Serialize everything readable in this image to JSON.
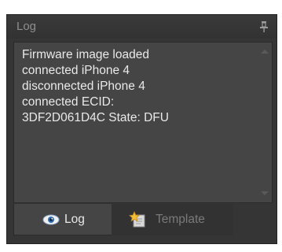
{
  "panel": {
    "title": "Log",
    "pin_icon": "pin-icon"
  },
  "log": {
    "lines": [
      "Firmware image loaded",
      "connected iPhone 4",
      "disconnected iPhone 4",
      "connected ECID:",
      "3DF2D061D4C State: DFU"
    ]
  },
  "tabs": [
    {
      "label": "Log",
      "icon": "eye-icon",
      "active": true
    },
    {
      "label": "Template",
      "icon": "star-document-icon",
      "active": false
    }
  ],
  "colors": {
    "panel_bg": "#353535",
    "log_bg": "#454545",
    "text": "#e9e9e9",
    "muted_text": "#8e8e8e"
  }
}
